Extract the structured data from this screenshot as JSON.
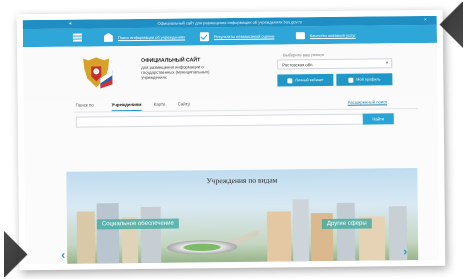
{
  "topbar": {
    "text": "Официальный сайт для размещения информации об учреждениях bus.gov.ru"
  },
  "nav": {
    "items": [
      {
        "label": "Поиск информации об учреждениях",
        "icon": "bank-icon"
      },
      {
        "label": "Результаты независимой оценки",
        "icon": "checkmark-icon"
      },
      {
        "label": "Качество оказания услуг",
        "icon": "briefcase-icon"
      }
    ]
  },
  "header": {
    "title": "ОФИЦИАЛЬНЫЙ САЙТ",
    "subtitle": "для размещения информации о государственных (муниципальных) учреждениях",
    "region_label": "Выберите ваш регион",
    "region_value": "Ростовская обл.",
    "cabinet_button": "Личный кабинет",
    "profile_button": "Мой профиль"
  },
  "tabs": {
    "items": [
      "Поиск по",
      "Учреждениям",
      "Карте",
      "Сайту"
    ],
    "active_index": 1,
    "advanced_search": "Расширенный поиск"
  },
  "search": {
    "placeholder": "",
    "button": "Найти"
  },
  "banner": {
    "title": "Учреждения по видам",
    "labels": [
      "Социальное обеспечение",
      "Другие сферы"
    ]
  },
  "colors": {
    "accent": "#1f98c8",
    "topbar": "#1f8fc3",
    "navbar": "#2ea6d8"
  }
}
